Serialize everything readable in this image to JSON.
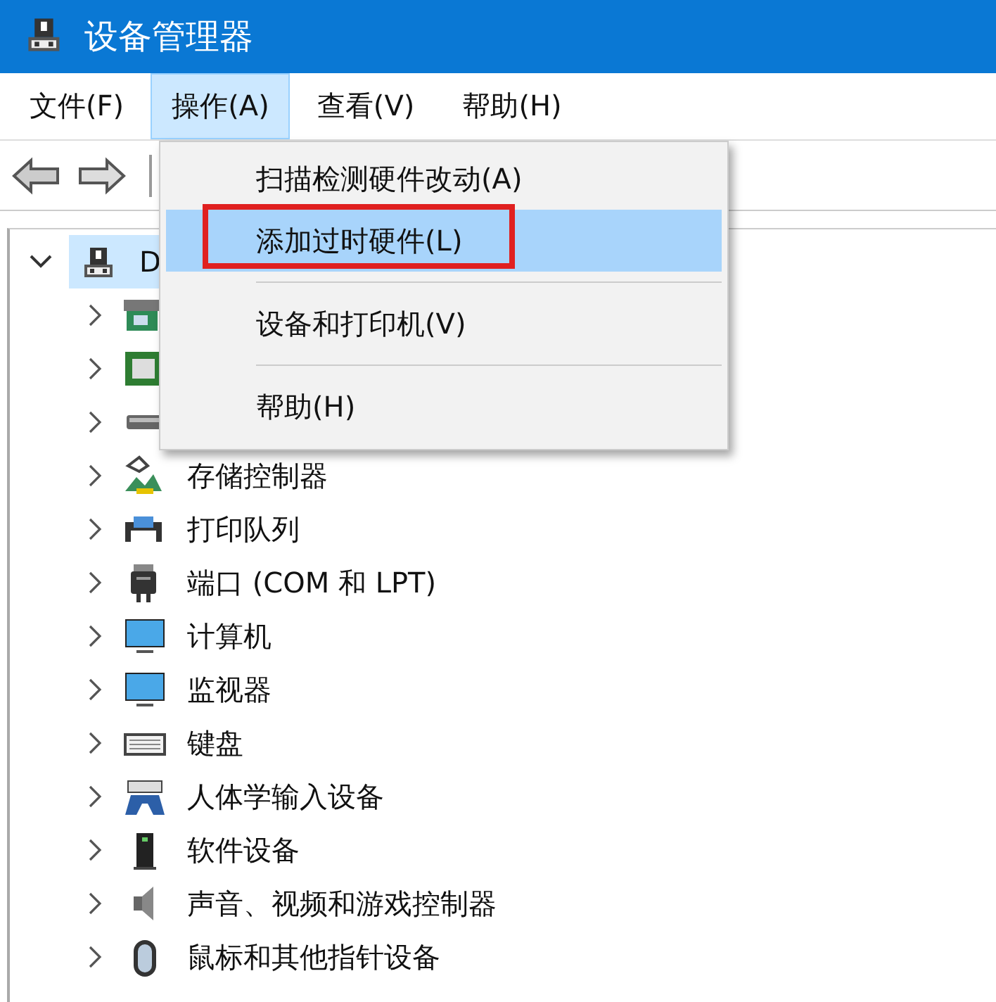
{
  "window": {
    "title": "设备管理器"
  },
  "menu_bar": [
    {
      "label": "文件(F)",
      "selected": false
    },
    {
      "label": "操作(A)",
      "selected": true
    },
    {
      "label": "查看(V)",
      "selected": false
    },
    {
      "label": "帮助(H)",
      "selected": false
    }
  ],
  "tree": {
    "root": {
      "label": "D",
      "expanded": true,
      "selected": true
    },
    "children": [
      {
        "kind": "network",
        "expanded": false
      },
      {
        "kind": "chip",
        "expanded": false
      },
      {
        "kind": "drive",
        "expanded": false
      },
      {
        "kind": "storage",
        "label": "存储控制器",
        "expanded": false
      },
      {
        "kind": "printer",
        "label": "打印队列",
        "expanded": false
      },
      {
        "kind": "port",
        "label": "端口 (COM 和 LPT)",
        "expanded": false
      },
      {
        "kind": "monitor",
        "label": "计算机",
        "expanded": false
      },
      {
        "kind": "monitor",
        "label": "监视器",
        "expanded": false
      },
      {
        "kind": "keyboard",
        "label": "键盘",
        "expanded": false
      },
      {
        "kind": "hid",
        "label": "人体学输入设备",
        "expanded": false
      },
      {
        "kind": "software",
        "label": "软件设备",
        "expanded": false
      },
      {
        "kind": "speaker",
        "label": "声音、视频和游戏控制器",
        "expanded": false
      },
      {
        "kind": "mouse",
        "label": "鼠标和其他指针设备",
        "expanded": false
      }
    ]
  },
  "context_menu": [
    {
      "kind": "item",
      "label": "扫描检测硬件改动(A)",
      "selected": false,
      "annotated": false
    },
    {
      "kind": "item",
      "label": "添加过时硬件(L)",
      "selected": true,
      "annotated": true
    },
    {
      "kind": "separator"
    },
    {
      "kind": "item",
      "label": "设备和打印机(V)",
      "selected": false,
      "annotated": false
    },
    {
      "kind": "separator"
    },
    {
      "kind": "item",
      "label": "帮助(H)",
      "selected": false,
      "annotated": false
    }
  ]
}
